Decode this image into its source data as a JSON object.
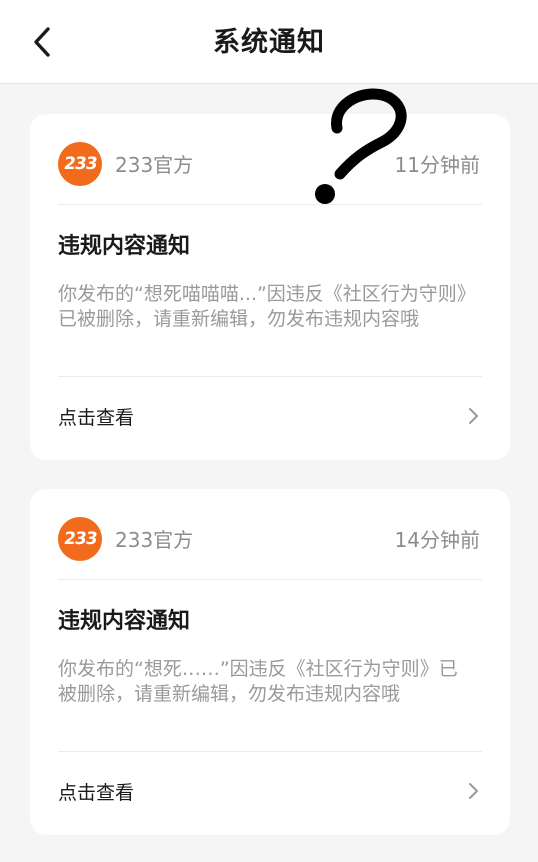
{
  "header": {
    "title": "系统通知",
    "back_icon": "chevron-left-icon"
  },
  "overlay": {
    "icon": "question-mark-icon"
  },
  "notifications": [
    {
      "logo_text": "233",
      "sender": "233官方",
      "time": "11分钟前",
      "title": "违规内容通知",
      "body": "你发布的“想死喵喵喵...”因违反《社区行为守则》已被删除，请重新编辑，勿发布违规内容哦",
      "action": "点击查看"
    },
    {
      "logo_text": "233",
      "sender": "233官方",
      "time": "14分钟前",
      "title": "违规内容通知",
      "body": "你发布的“想死……”因违反《社区行为守则》已被删除，请重新编辑，勿发布违规内容哦",
      "action": "点击查看"
    }
  ],
  "colors": {
    "background": "#f5f5f5",
    "card": "#ffffff",
    "brand_orange": "#f26a1b",
    "muted_text": "#8c8c8c"
  }
}
